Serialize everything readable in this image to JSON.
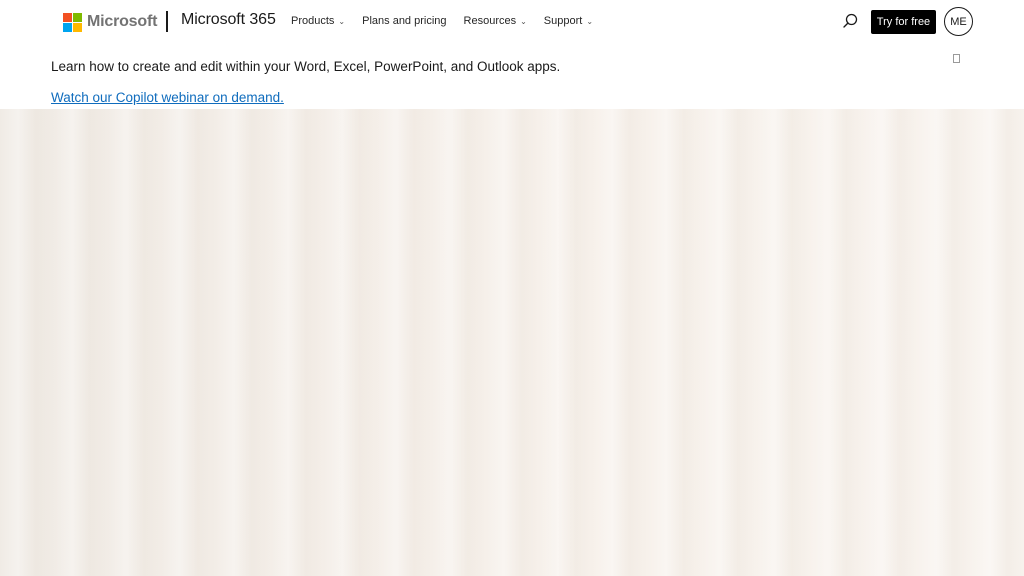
{
  "header": {
    "brand": "Microsoft",
    "brand_colors": [
      "#f25022",
      "#7fba00",
      "#00a4ef",
      "#ffb900"
    ],
    "product": "Microsoft 365",
    "nav": [
      {
        "label": "Products",
        "has_dropdown": true
      },
      {
        "label": "Plans and pricing",
        "has_dropdown": false
      },
      {
        "label": "Resources",
        "has_dropdown": true
      },
      {
        "label": "Support",
        "has_dropdown": true
      }
    ],
    "search_icon": "search-icon",
    "cta_label": "Try for free",
    "avatar_initials": "ME"
  },
  "banner": {
    "text": "Learn how to create and edit within your Word, Excel, PowerPoint, and Outlook apps.",
    "link_text": "Watch our Copilot webinar on demand."
  },
  "colors": {
    "link": "#0f6cbd",
    "cta_bg": "#000000",
    "hero_bg": "#f4eee8"
  }
}
